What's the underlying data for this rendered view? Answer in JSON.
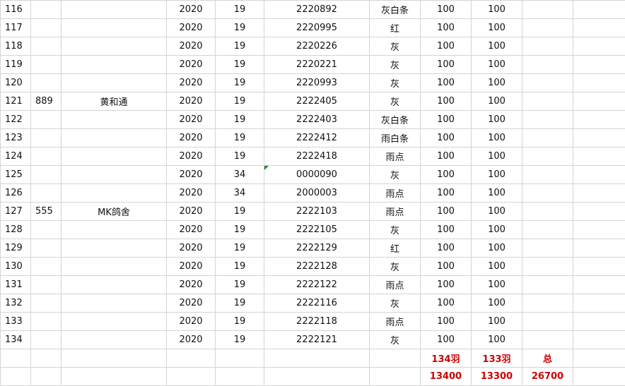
{
  "rows": [
    {
      "idx": "116",
      "code": "",
      "name": "",
      "year": "2020",
      "age": "19",
      "ring": "2220892",
      "color": "灰白条",
      "a": "100",
      "b": "100"
    },
    {
      "idx": "117",
      "code": "",
      "name": "",
      "year": "2020",
      "age": "19",
      "ring": "2220995",
      "color": "红",
      "a": "100",
      "b": "100"
    },
    {
      "idx": "118",
      "code": "",
      "name": "",
      "year": "2020",
      "age": "19",
      "ring": "2220226",
      "color": "灰",
      "a": "100",
      "b": "100"
    },
    {
      "idx": "119",
      "code": "",
      "name": "",
      "year": "2020",
      "age": "19",
      "ring": "2220221",
      "color": "灰",
      "a": "100",
      "b": "100"
    },
    {
      "idx": "120",
      "code": "",
      "name": "",
      "year": "2020",
      "age": "19",
      "ring": "2220993",
      "color": "灰",
      "a": "100",
      "b": "100"
    },
    {
      "idx": "121",
      "code": "889",
      "name": "黄和通",
      "year": "2020",
      "age": "19",
      "ring": "2222405",
      "color": "灰",
      "a": "100",
      "b": "100"
    },
    {
      "idx": "122",
      "code": "",
      "name": "",
      "year": "2020",
      "age": "19",
      "ring": "2222403",
      "color": "灰白条",
      "a": "100",
      "b": "100"
    },
    {
      "idx": "123",
      "code": "",
      "name": "",
      "year": "2020",
      "age": "19",
      "ring": "2222412",
      "color": "雨白条",
      "a": "100",
      "b": "100"
    },
    {
      "idx": "124",
      "code": "",
      "name": "",
      "year": "2020",
      "age": "19",
      "ring": "2222418",
      "color": "雨点",
      "a": "100",
      "b": "100"
    },
    {
      "idx": "125",
      "code": "",
      "name": "",
      "year": "2020",
      "age": "34",
      "ring": "0000090",
      "color": "灰",
      "a": "100",
      "b": "100"
    },
    {
      "idx": "126",
      "code": "",
      "name": "",
      "year": "2020",
      "age": "34",
      "ring": "2000003",
      "color": "雨点",
      "a": "100",
      "b": "100"
    },
    {
      "idx": "127",
      "code": "555",
      "name": "MK鸽舍",
      "year": "2020",
      "age": "19",
      "ring": "2222103",
      "color": "雨点",
      "a": "100",
      "b": "100"
    },
    {
      "idx": "128",
      "code": "",
      "name": "",
      "year": "2020",
      "age": "19",
      "ring": "2222105",
      "color": "灰",
      "a": "100",
      "b": "100"
    },
    {
      "idx": "129",
      "code": "",
      "name": "",
      "year": "2020",
      "age": "19",
      "ring": "2222129",
      "color": "红",
      "a": "100",
      "b": "100"
    },
    {
      "idx": "130",
      "code": "",
      "name": "",
      "year": "2020",
      "age": "19",
      "ring": "2222128",
      "color": "灰",
      "a": "100",
      "b": "100"
    },
    {
      "idx": "131",
      "code": "",
      "name": "",
      "year": "2020",
      "age": "19",
      "ring": "2222122",
      "color": "雨点",
      "a": "100",
      "b": "100"
    },
    {
      "idx": "132",
      "code": "",
      "name": "",
      "year": "2020",
      "age": "19",
      "ring": "2222116",
      "color": "灰",
      "a": "100",
      "b": "100"
    },
    {
      "idx": "133",
      "code": "",
      "name": "",
      "year": "2020",
      "age": "19",
      "ring": "2222118",
      "color": "雨点",
      "a": "100",
      "b": "100"
    },
    {
      "idx": "134",
      "code": "",
      "name": "",
      "year": "2020",
      "age": "19",
      "ring": "2222121",
      "color": "灰",
      "a": "100",
      "b": "100"
    }
  ],
  "summary": {
    "count_a": "134羽",
    "count_b": "133羽",
    "total_label": "总",
    "sum_a": "13400",
    "sum_b": "13300",
    "sum_total": "26700"
  },
  "colors": {
    "summary_text": "#cc0000",
    "grid_line": "#d4d4d4",
    "comment_marker": "#1e8a2e"
  }
}
